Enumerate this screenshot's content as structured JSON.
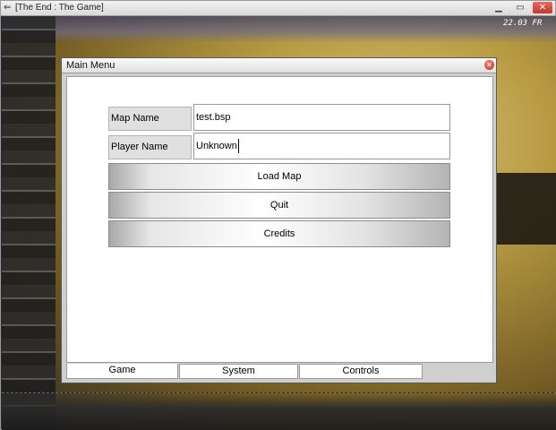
{
  "os_window": {
    "title": "[The End : The Game]",
    "icon": "back-arrow-icon",
    "controls": [
      "minimize-icon",
      "maximize-icon",
      "close-icon"
    ]
  },
  "background": {
    "readout": "22.03 FR"
  },
  "menu": {
    "title": "Main Menu",
    "fields": {
      "map_name_label": "Map Name",
      "map_name_value": "test.bsp",
      "player_name_label": "Player Name",
      "player_name_value": "Unknown"
    },
    "buttons": {
      "load_map": "Load Map",
      "quit": "Quit",
      "credits": "Credits"
    },
    "tabs": [
      {
        "label": "Game",
        "active": true
      },
      {
        "label": "System",
        "active": false
      },
      {
        "label": "Controls",
        "active": false
      }
    ],
    "close_glyph": "×"
  },
  "colors": {
    "close_accent": "#c0281c",
    "panel_bg": "#ffffff",
    "background_tint": "#b89a42"
  }
}
